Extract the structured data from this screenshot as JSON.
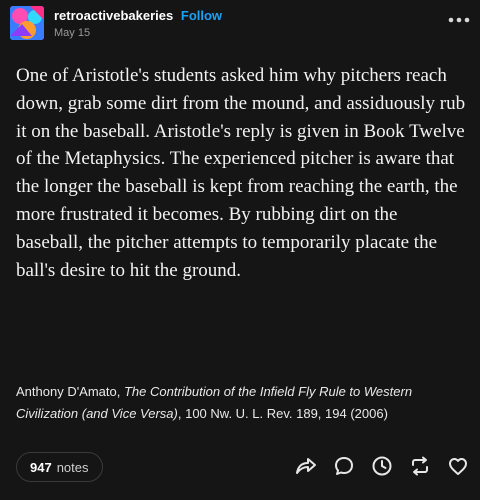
{
  "header": {
    "username": "retroactivebakeries",
    "follow_label": "Follow",
    "date": "May 15"
  },
  "post": {
    "body": "One of Aristotle's students asked him why pitchers reach down, grab some dirt from the mound, and assiduously rub it on the baseball. Aristotle's reply is given in Book Twelve of the Metaphysics. The experienced pitcher is aware that the longer the baseball is kept from reaching the earth, the more frustrated it becomes. By rubbing dirt on the baseball, the pitcher attempts to temporarily placate the ball's desire to hit the ground.",
    "citation_author": "Anthony D'Amato, ",
    "citation_title": "The Contribution of the Infield Fly Rule to Western Civilization (and Vice Versa)",
    "citation_source": ", 100 Nw. U. L. Rev. 189, 194 (2006)"
  },
  "footer": {
    "notes_count": "947",
    "notes_label": "notes"
  },
  "icons": {
    "more": "more-horizontal-icon",
    "share": "share-icon",
    "reply": "reply-icon",
    "history": "clock-icon",
    "reblog": "reblog-icon",
    "like": "heart-icon"
  },
  "colors": {
    "background": "#151515",
    "accent": "#1da1f2",
    "text": "#f2f2f2",
    "muted": "#9a9a9a"
  }
}
